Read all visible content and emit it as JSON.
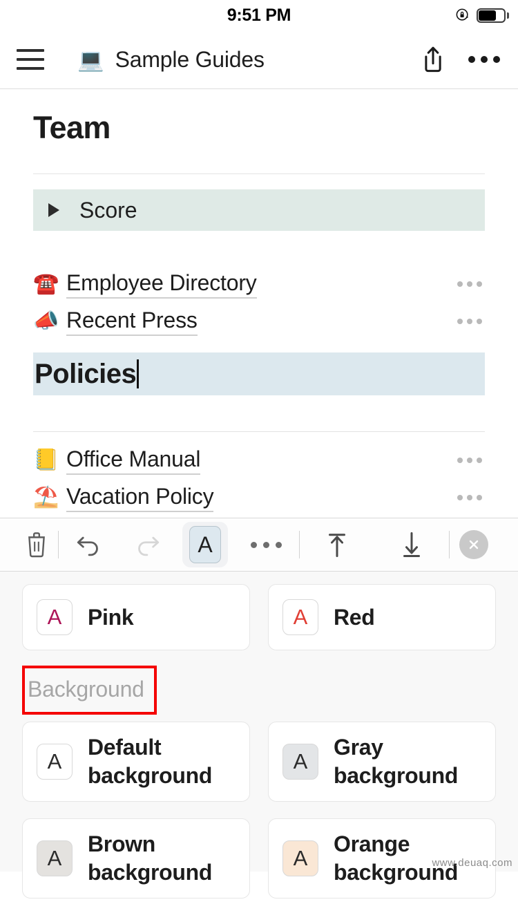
{
  "status_bar": {
    "time": "9:51 PM",
    "rotation_lock_icon": "rotation-lock-icon",
    "battery_icon": "battery-icon"
  },
  "nav_bar": {
    "menu_icon": "hamburger-menu-icon",
    "doc_icon": "💻",
    "title": "Sample Guides",
    "share_icon": "share-icon",
    "more_icon": "more-options-icon"
  },
  "document": {
    "title": "Team",
    "toggle": {
      "label": "Score",
      "expanded": false,
      "background_color": "#dfeae6"
    },
    "links": [
      {
        "emoji": "☎️",
        "label": "Employee Directory"
      },
      {
        "emoji": "📣",
        "label": "Recent Press"
      }
    ],
    "selected_heading": {
      "text": "Policies",
      "highlight_color": "#dce8ee"
    },
    "links_after": [
      {
        "emoji": "📒",
        "label": "Office Manual"
      },
      {
        "emoji": "⛱️",
        "label": "Vacation Policy"
      }
    ]
  },
  "toolbar": {
    "delete_label": "delete-icon",
    "undo_label": "undo-icon",
    "redo_label": "redo-icon",
    "format_label": "A",
    "more_label": "more-icon",
    "outdent_label": "move-up-icon",
    "indent_label": "move-down-icon",
    "close_label": "close-icon"
  },
  "panel": {
    "color_options": [
      {
        "label": "Pink",
        "letter": "A",
        "letter_color": "#ad1457",
        "swatch_bg": "#ffffff"
      },
      {
        "label": "Red",
        "letter": "A",
        "letter_color": "#e03e34",
        "swatch_bg": "#ffffff"
      }
    ],
    "section_label": "Background",
    "section_label_highlighted": true,
    "highlight_border_color": "#f40000",
    "background_options": [
      {
        "label": "Default\nbackground",
        "letter": "A",
        "letter_color": "#2b2b2b",
        "swatch_bg": "#ffffff"
      },
      {
        "label": "Gray\nbackground",
        "letter": "A",
        "letter_color": "#2b2b2b",
        "swatch_bg": "#e3e5e7"
      },
      {
        "label": "Brown\nbackground",
        "letter": "A",
        "letter_color": "#2b2b2b",
        "swatch_bg": "#e4e2df"
      },
      {
        "label": "Orange\nbackground",
        "letter": "A",
        "letter_color": "#2b2b2b",
        "swatch_bg": "#fae7d5"
      }
    ]
  },
  "watermark": "www.deuaq.com"
}
